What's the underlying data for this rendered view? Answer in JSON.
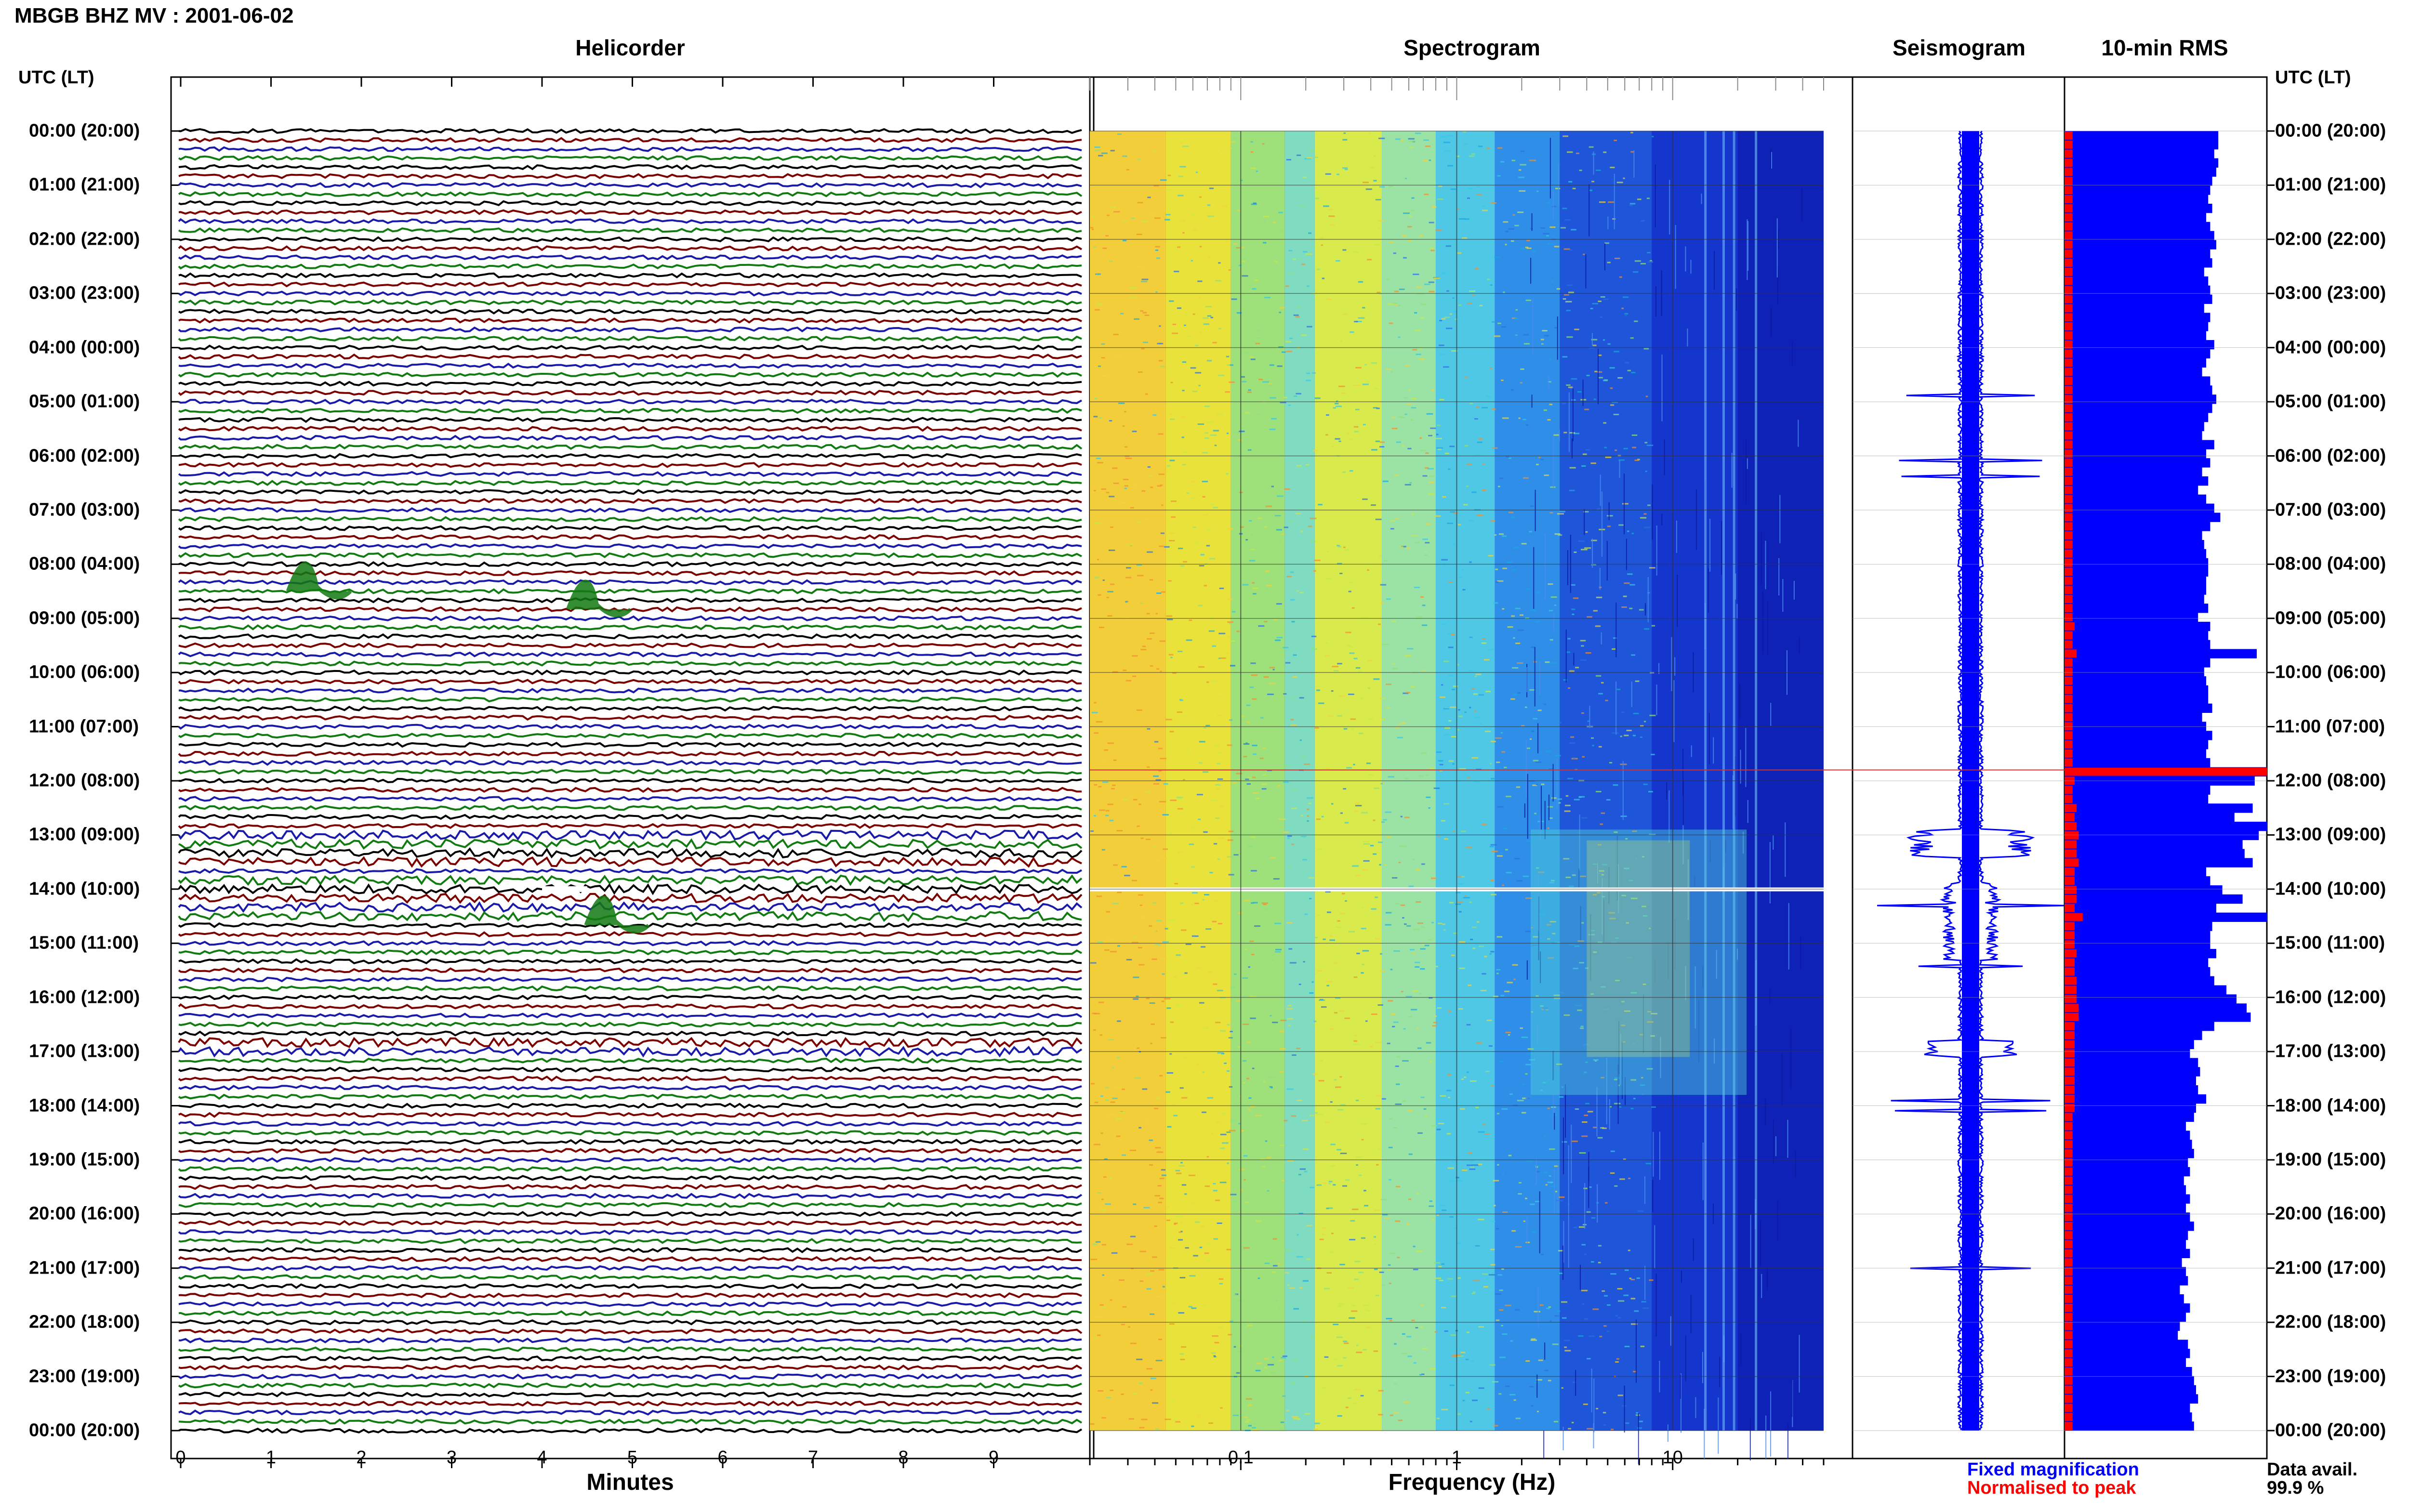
{
  "title": "MBGB BHZ MV : 2001-06-02",
  "colors": {
    "trace_cycle": [
      "#000000",
      "#7a0000",
      "#1a1aa8",
      "#117a11"
    ],
    "fixed": "#0000ff",
    "normalised": "#ff0000"
  },
  "panels": {
    "helicorder": "Helicorder",
    "spectrogram": "Spectrogram",
    "seismogram": "Seismogram",
    "rms": "10-min RMS"
  },
  "utc_label_left": "UTC (LT)",
  "utc_label_right": "UTC (LT)",
  "time_labels": [
    "00:00 (20:00)",
    "01:00 (21:00)",
    "02:00 (22:00)",
    "03:00 (23:00)",
    "04:00 (00:00)",
    "05:00 (01:00)",
    "06:00 (02:00)",
    "07:00 (03:00)",
    "08:00 (04:00)",
    "09:00 (05:00)",
    "10:00 (06:00)",
    "11:00 (07:00)",
    "12:00 (08:00)",
    "13:00 (09:00)",
    "14:00 (10:00)",
    "15:00 (11:00)",
    "16:00 (12:00)",
    "17:00 (13:00)",
    "18:00 (14:00)",
    "19:00 (15:00)",
    "20:00 (16:00)",
    "21:00 (17:00)",
    "22:00 (18:00)",
    "23:00 (19:00)",
    "00:00 (20:00)"
  ],
  "helicorder_x_ticks": [
    "0",
    "1",
    "2",
    "3",
    "4",
    "5",
    "6",
    "7",
    "8",
    "9"
  ],
  "helicorder_xlabel": "Minutes",
  "spectrogram_x_ticks": [
    "0.1",
    "1",
    "10"
  ],
  "spectrogram_xlabel": "Frequency (Hz)",
  "legend": {
    "fixed": "Fixed magnification",
    "normalised": "Normalised to peak",
    "data_avail_label": "Data avail.",
    "data_avail_value": "99.9 %"
  },
  "chart_data": {
    "type": "heatmap",
    "helicorder": {
      "xlim": [
        0,
        10
      ],
      "lines_per_hour": 6,
      "hours": 24
    },
    "spectrogram": {
      "x_scale": "log",
      "xlim": [
        0.02,
        50
      ]
    },
    "rms_fixed": [
      0.76,
      0.76,
      0.74,
      0.76,
      0.75,
      0.73,
      0.72,
      0.71,
      0.73,
      0.7,
      0.72,
      0.74,
      0.75,
      0.72,
      0.73,
      0.69,
      0.71,
      0.72,
      0.73,
      0.69,
      0.72,
      0.71,
      0.7,
      0.74,
      0.72,
      0.7,
      0.68,
      0.72,
      0.73,
      0.75,
      0.73,
      0.71,
      0.69,
      0.68,
      0.74,
      0.7,
      0.72,
      0.68,
      0.71,
      0.66,
      0.7,
      0.74,
      0.77,
      0.72,
      0.68,
      0.69,
      0.7,
      0.71,
      0.71,
      0.7,
      0.7,
      0.69,
      0.71,
      0.66,
      0.72,
      0.71,
      0.72,
      0.95,
      0.72,
      0.69,
      0.7,
      0.71,
      0.71,
      0.73,
      0.68,
      0.7,
      0.73,
      0.71,
      0.7,
      0.72,
      1.0,
      0.94,
      0.72,
      0.71,
      0.93,
      0.84,
      1.0,
      0.96,
      0.88,
      0.89,
      0.93,
      0.7,
      0.72,
      0.78,
      0.88,
      0.75,
      1.0,
      0.73,
      0.72,
      0.72,
      0.75,
      0.71,
      0.72,
      0.74,
      0.8,
      0.85,
      0.9,
      0.92,
      0.74,
      0.68,
      0.64,
      0.62,
      0.66,
      0.67,
      0.65,
      0.66,
      0.7,
      0.65,
      0.64,
      0.6,
      0.62,
      0.63,
      0.64,
      0.61,
      0.62,
      0.59,
      0.6,
      0.62,
      0.6,
      0.62,
      0.64,
      0.61,
      0.6,
      0.62,
      0.58,
      0.6,
      0.61,
      0.57,
      0.59,
      0.62,
      0.6,
      0.57,
      0.56,
      0.61,
      0.62,
      0.6,
      0.63,
      0.64,
      0.65,
      0.66,
      0.62,
      0.63,
      0.64
    ],
    "rms_normalised": [
      0.04,
      0.04,
      0.04,
      0.04,
      0.04,
      0.04,
      0.04,
      0.04,
      0.04,
      0.04,
      0.04,
      0.04,
      0.04,
      0.04,
      0.04,
      0.04,
      0.04,
      0.04,
      0.04,
      0.04,
      0.04,
      0.04,
      0.04,
      0.04,
      0.04,
      0.04,
      0.04,
      0.04,
      0.04,
      0.04,
      0.04,
      0.04,
      0.04,
      0.04,
      0.04,
      0.04,
      0.04,
      0.04,
      0.04,
      0.04,
      0.04,
      0.04,
      0.04,
      0.04,
      0.04,
      0.04,
      0.04,
      0.04,
      0.04,
      0.04,
      0.04,
      0.04,
      0.04,
      0.04,
      0.05,
      0.04,
      0.04,
      0.06,
      0.04,
      0.04,
      0.04,
      0.04,
      0.04,
      0.04,
      0.04,
      0.04,
      0.04,
      0.04,
      0.04,
      0.04,
      1.0,
      0.05,
      0.04,
      0.04,
      0.06,
      0.05,
      0.06,
      0.07,
      0.06,
      0.06,
      0.07,
      0.05,
      0.05,
      0.06,
      0.06,
      0.05,
      0.09,
      0.05,
      0.05,
      0.05,
      0.06,
      0.05,
      0.05,
      0.06,
      0.06,
      0.06,
      0.07,
      0.07,
      0.05,
      0.05,
      0.05,
      0.05,
      0.05,
      0.05,
      0.05,
      0.05,
      0.05,
      0.05,
      0.04,
      0.04,
      0.04,
      0.04,
      0.04,
      0.04,
      0.04,
      0.04,
      0.04,
      0.04,
      0.04,
      0.04,
      0.04,
      0.04,
      0.04,
      0.04,
      0.04,
      0.04,
      0.04,
      0.04,
      0.04,
      0.04,
      0.04,
      0.04,
      0.04,
      0.04,
      0.04,
      0.04,
      0.04,
      0.04,
      0.04,
      0.04,
      0.04,
      0.04,
      0.04
    ],
    "events": [
      {
        "panel": "helicorder",
        "line": 51,
        "x_min": 1.4,
        "label": ""
      },
      {
        "panel": "helicorder",
        "line": 53,
        "x_min": 4.5,
        "label": ""
      },
      {
        "panel": "helicorder",
        "line": 88,
        "x_min": 4.7,
        "label": ""
      }
    ]
  }
}
